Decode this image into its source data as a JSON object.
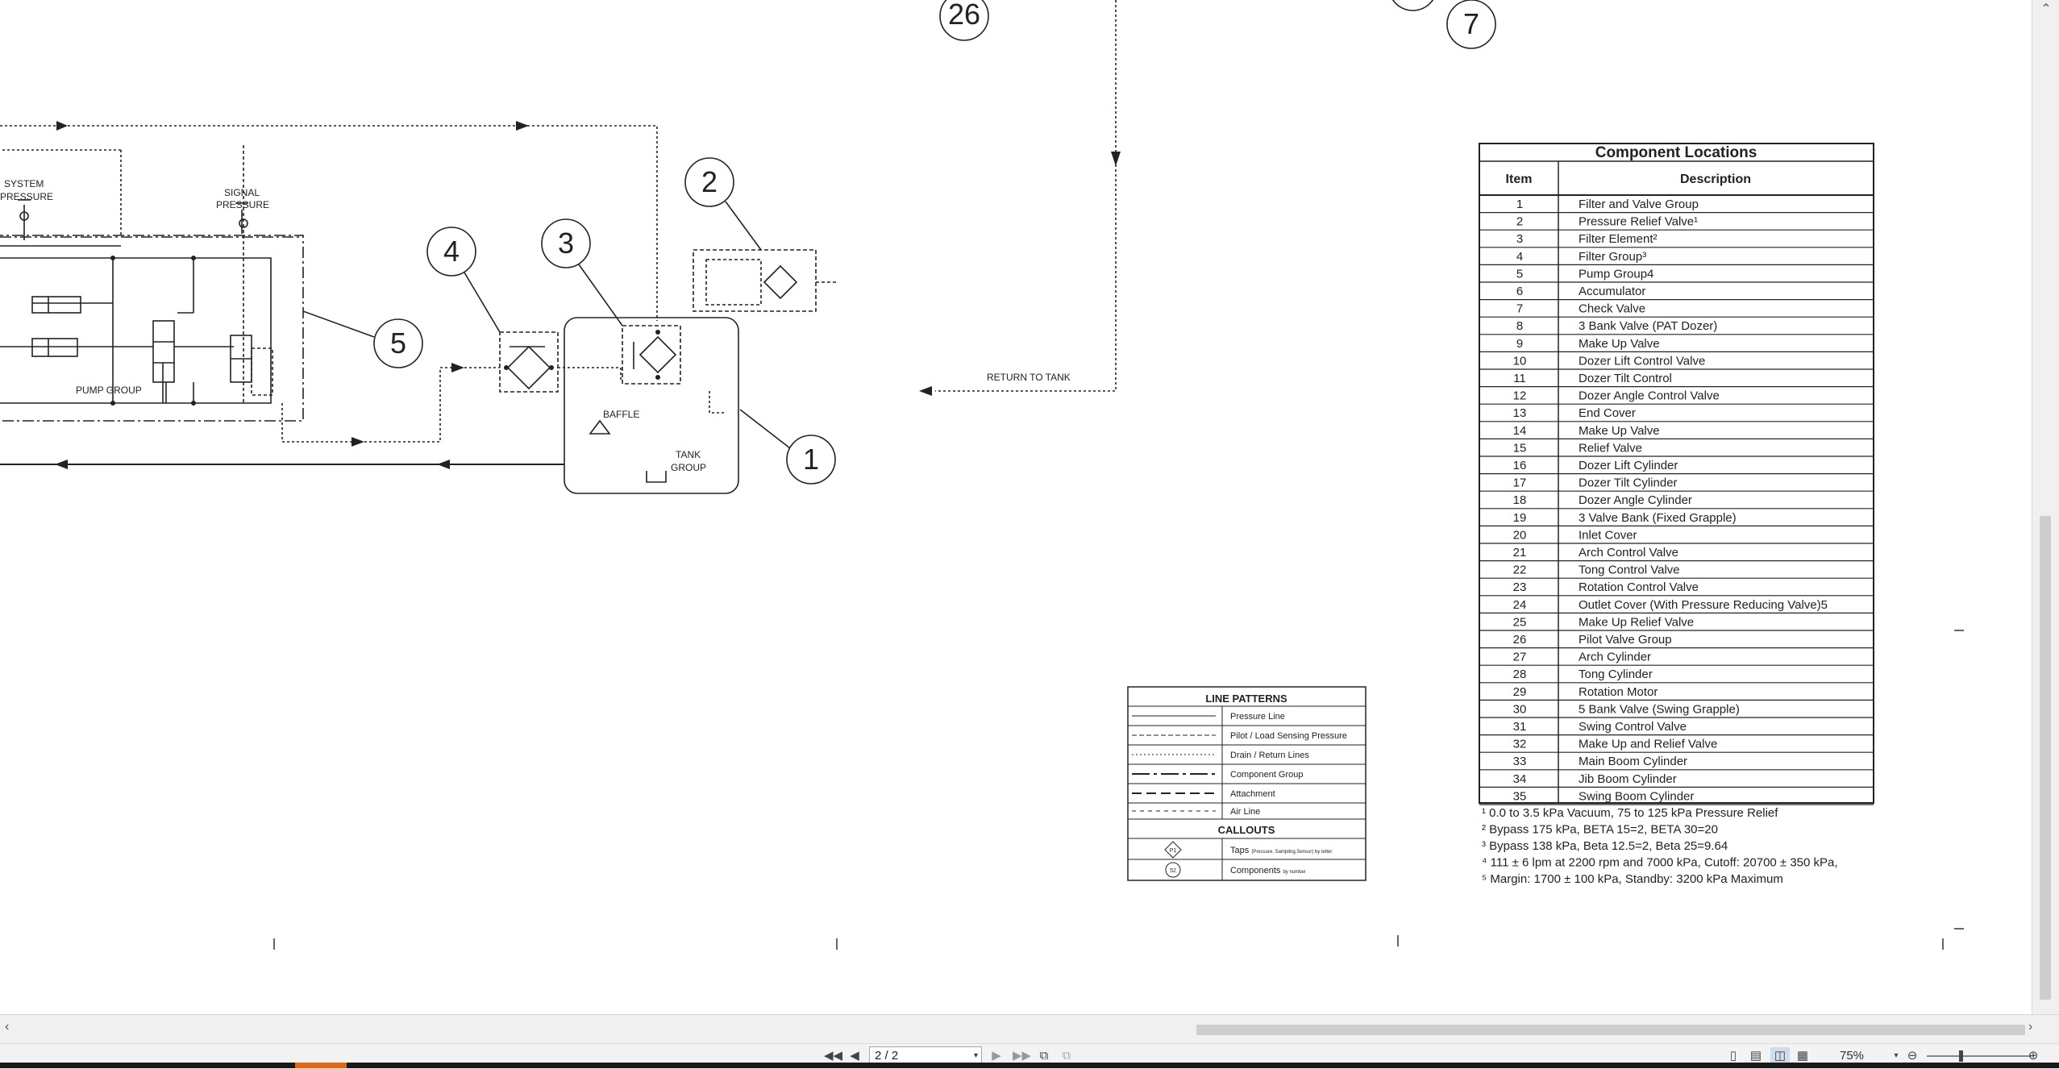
{
  "viewer": {
    "page_indicator": "2 / 2",
    "zoom": "75%",
    "icons": {
      "first_page": "first-page-icon",
      "prev_page": "prev-page-icon",
      "next_page": "next-page-icon",
      "last_page": "last-page-icon",
      "zoom_out": "zoom-out-icon",
      "zoom_in": "zoom-in-icon"
    },
    "accent_color": "#d86b1c"
  },
  "diagram": {
    "callouts_top": [
      "26",
      "7"
    ],
    "callouts": [
      "1",
      "2",
      "3",
      "4",
      "5"
    ],
    "labels": {
      "system_pressure": [
        "SYSTEM",
        "PRESSURE"
      ],
      "signal_pressure": [
        "SIGNAL",
        "PRESSURE"
      ],
      "pump_group": "PUMP GROUP",
      "baffle": "BAFFLE",
      "tank_group": [
        "TANK",
        "GROUP"
      ],
      "return_to_tank": "RETURN TO TANK"
    }
  },
  "component_table": {
    "title": "Component Locations",
    "headers": [
      "Item",
      "Description"
    ],
    "rows": [
      [
        "1",
        "Filter and Valve Group"
      ],
      [
        "2",
        "Pressure Relief Valve¹"
      ],
      [
        "3",
        "Filter Element²"
      ],
      [
        "4",
        "Filter Group³"
      ],
      [
        "5",
        "Pump Group4"
      ],
      [
        "6",
        "Accumulator"
      ],
      [
        "7",
        "Check Valve"
      ],
      [
        "8",
        "3 Bank Valve (PAT Dozer)"
      ],
      [
        "9",
        "Make Up Valve"
      ],
      [
        "10",
        "Dozer Lift Control Valve"
      ],
      [
        "11",
        "Dozer Tilt Control"
      ],
      [
        "12",
        "Dozer Angle Control Valve"
      ],
      [
        "13",
        "End Cover"
      ],
      [
        "14",
        "Make Up Valve"
      ],
      [
        "15",
        "Relief Valve"
      ],
      [
        "16",
        "Dozer Lift Cylinder"
      ],
      [
        "17",
        "Dozer Tilt Cylinder"
      ],
      [
        "18",
        "Dozer Angle Cylinder"
      ],
      [
        "19",
        "3 Valve Bank (Fixed Grapple)"
      ],
      [
        "20",
        "Inlet Cover"
      ],
      [
        "21",
        "Arch Control Valve"
      ],
      [
        "22",
        "Tong Control Valve"
      ],
      [
        "23",
        "Rotation Control Valve"
      ],
      [
        "24",
        "Outlet Cover (With Pressure Reducing Valve)5"
      ],
      [
        "25",
        "Make Up Relief Valve"
      ],
      [
        "26",
        "Pilot Valve Group"
      ],
      [
        "27",
        "Arch Cylinder"
      ],
      [
        "28",
        "Tong Cylinder"
      ],
      [
        "29",
        "Rotation Motor"
      ],
      [
        "30",
        "5 Bank Valve (Swing Grapple)"
      ],
      [
        "31",
        "Swing Control Valve"
      ],
      [
        "32",
        "Make Up and Relief Valve"
      ],
      [
        "33",
        "Main Boom Cylinder"
      ],
      [
        "34",
        "Jib Boom Cylinder"
      ],
      [
        "35",
        "Swing Boom Cylinder"
      ]
    ],
    "footnotes": [
      "¹ 0.0 to 3.5 kPa Vacuum, 75 to 125 kPa Pressure Relief",
      "² Bypass 175 kPa, BETA 15=2, BETA 30=20",
      "³ Bypass 138 kPa, Beta 12.5=2, Beta 25=9.64",
      "⁴ 111 ± 6 lpm at 2200 rpm and 7000 kPa, Cutoff: 20700 ± 350 kPa,",
      "⁵ Margin: 1700 ± 100 kPa, Standby: 3200 kPa Maximum"
    ]
  },
  "legend": {
    "title": "LINE PATTERNS",
    "patterns": [
      "Pressure Line",
      "Pilot / Load Sensing Pressure",
      "Drain / Return Lines",
      "Component Group",
      "Attachment",
      "Air Line"
    ],
    "callouts_title": "CALLOUTS",
    "taps_symbol": "P1",
    "taps": "Taps",
    "taps_note": "(Pressure, Sampling,Sensor) by letter",
    "components_symbol": "52",
    "components": "Components",
    "components_note": "by number"
  }
}
